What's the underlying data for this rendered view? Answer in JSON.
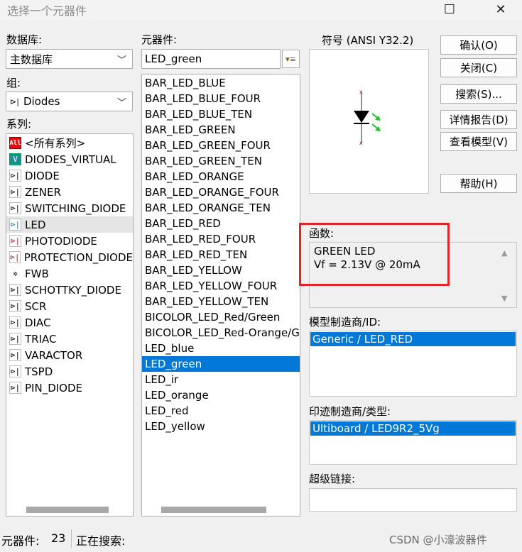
{
  "window": {
    "title": "选择一个元器件",
    "maximize_icon": "maximize-icon",
    "close_icon": "close-icon"
  },
  "database": {
    "label": "数据库:",
    "value": "主数据库"
  },
  "group": {
    "label": "组:",
    "value": "Diodes"
  },
  "family": {
    "label": "系列:",
    "items": [
      {
        "label": "<所有系列>",
        "icon": "all-icon"
      },
      {
        "label": "DIODES_VIRTUAL",
        "icon": "virtual-diode-icon"
      },
      {
        "label": "DIODE",
        "icon": "diode-icon"
      },
      {
        "label": "ZENER",
        "icon": "zener-icon"
      },
      {
        "label": "SWITCHING_DIODE",
        "icon": "switching-diode-icon"
      },
      {
        "label": "LED",
        "icon": "led-icon"
      },
      {
        "label": "PHOTODIODE",
        "icon": "photodiode-icon"
      },
      {
        "label": "PROTECTION_DIODE",
        "icon": "protection-diode-icon"
      },
      {
        "label": "FWB",
        "icon": "bridge-icon"
      },
      {
        "label": "SCHOTTKY_DIODE",
        "icon": "schottky-icon"
      },
      {
        "label": "SCR",
        "icon": "scr-icon"
      },
      {
        "label": "DIAC",
        "icon": "diac-icon"
      },
      {
        "label": "TRIAC",
        "icon": "triac-icon"
      },
      {
        "label": "VARACTOR",
        "icon": "varactor-icon"
      },
      {
        "label": "TSPD",
        "icon": "tspd-icon"
      },
      {
        "label": "PIN_DIODE",
        "icon": "pin-diode-icon"
      }
    ]
  },
  "component": {
    "label": "元器件:",
    "search_value": "LED_green",
    "filter_icon": "filter-icon",
    "items": [
      "BAR_LED_BLUE",
      "BAR_LED_BLUE_FOUR",
      "BAR_LED_BLUE_TEN",
      "BAR_LED_GREEN",
      "BAR_LED_GREEN_FOUR",
      "BAR_LED_GREEN_TEN",
      "BAR_LED_ORANGE",
      "BAR_LED_ORANGE_FOUR",
      "BAR_LED_ORANGE_TEN",
      "BAR_LED_RED",
      "BAR_LED_RED_FOUR",
      "BAR_LED_RED_TEN",
      "BAR_LED_YELLOW",
      "BAR_LED_YELLOW_FOUR",
      "BAR_LED_YELLOW_TEN",
      "BICOLOR_LED_Red/Green",
      "BICOLOR_LED_Red-Orange/Green",
      "LED_blue",
      "LED_green",
      "LED_ir",
      "LED_orange",
      "LED_red",
      "LED_yellow"
    ],
    "selected": "LED_green"
  },
  "symbol": {
    "label": "符号 (ANSI Y32.2)",
    "icon": "led-symbol-icon"
  },
  "buttons": {
    "ok": "确认(O)",
    "close": "关闭(C)",
    "search": "搜索(S)...",
    "report": "详情报告(D)",
    "view_model": "查看模型(V)",
    "help": "帮助(H)"
  },
  "function": {
    "label": "函数:",
    "line1": "GREEN LED",
    "line2": "Vf = 2.13V @ 20mA"
  },
  "model_maker": {
    "label": "模型制造商/ID:",
    "value": "Generic / LED_RED"
  },
  "footprint_maker": {
    "label": "印迹制造商/类型:",
    "value": "Ultiboard / LED9R2_5Vg"
  },
  "hyperlink": {
    "label": "超级链接:",
    "value": ""
  },
  "status": {
    "count_label": "元器件:",
    "count_value": "23",
    "searching_label": "正在搜索:"
  },
  "watermark": "CSDN @小濠波器件",
  "colors": {
    "selection": "#0078d7",
    "highlight_box": "#e0242b",
    "led_arrows": "#22c022"
  }
}
